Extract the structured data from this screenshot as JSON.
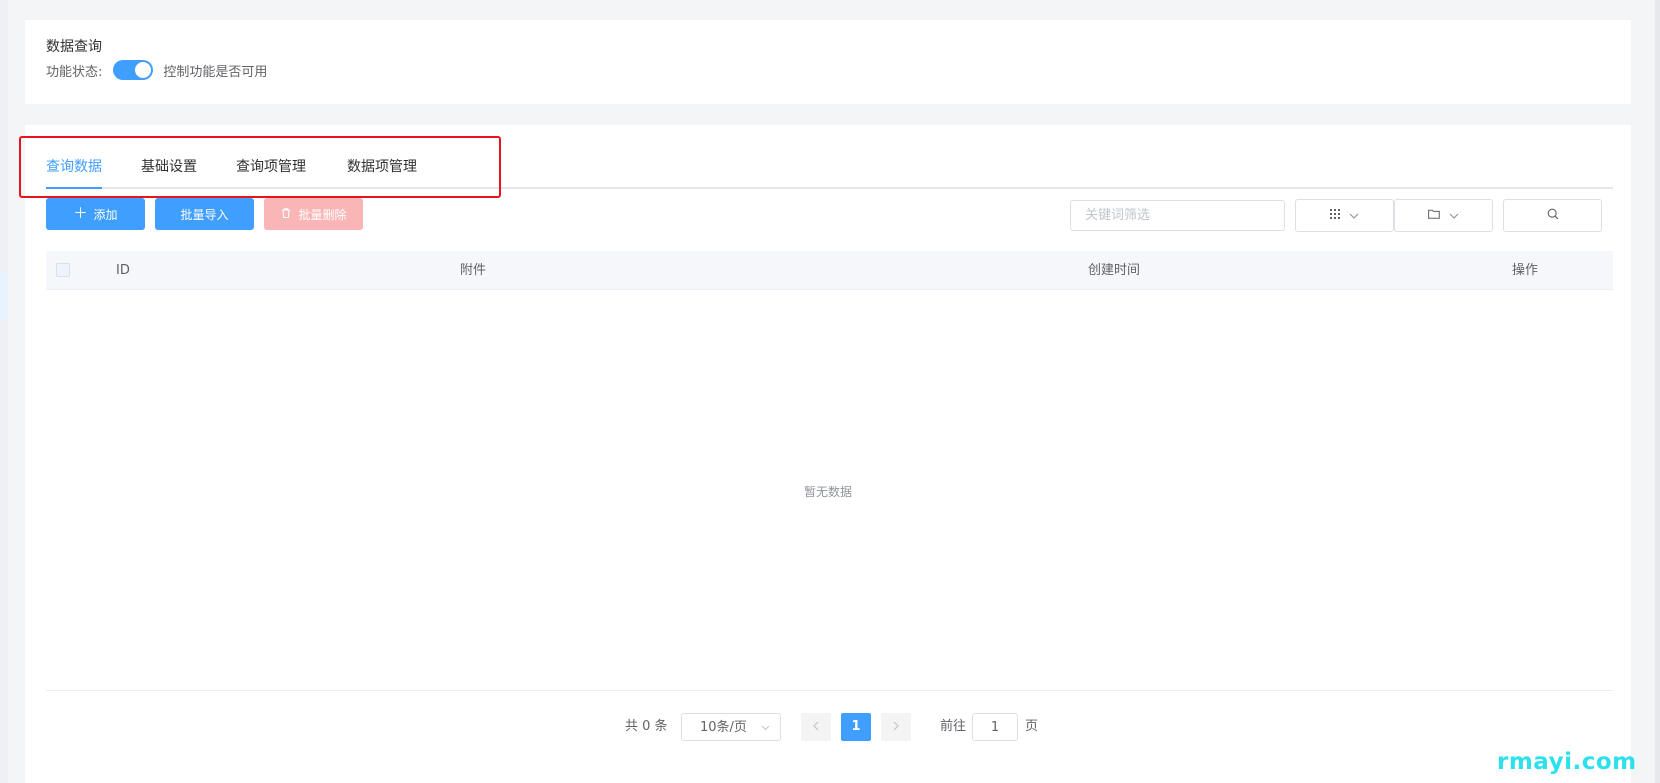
{
  "header": {
    "title": "数据查询",
    "status_label": "功能状态:",
    "status_enabled": true,
    "status_hint": "控制功能是否可用"
  },
  "tabs": [
    {
      "label": "查询数据",
      "active": true
    },
    {
      "label": "基础设置",
      "active": false
    },
    {
      "label": "查询项管理",
      "active": false
    },
    {
      "label": "数据项管理",
      "active": false
    }
  ],
  "toolbar": {
    "add_label": "添加",
    "import_label": "批量导入",
    "delete_label": "批量删除",
    "search_placeholder": "关键词筛选",
    "search_value": ""
  },
  "table": {
    "columns": [
      "ID",
      "附件",
      "创建时间",
      "操作"
    ],
    "rows": [],
    "empty_text": "暂无数据"
  },
  "pagination": {
    "total_text": "共 0 条",
    "page_size": "10条/页",
    "current_page": "1",
    "goto_prefix": "前往",
    "goto_value": "1",
    "goto_suffix": "页"
  },
  "watermark": "rmayi.com",
  "colors": {
    "accent": "#409eff",
    "danger_disabled": "#fab6b6",
    "highlight": "#e6141b",
    "watermark": "#2de1ec"
  }
}
